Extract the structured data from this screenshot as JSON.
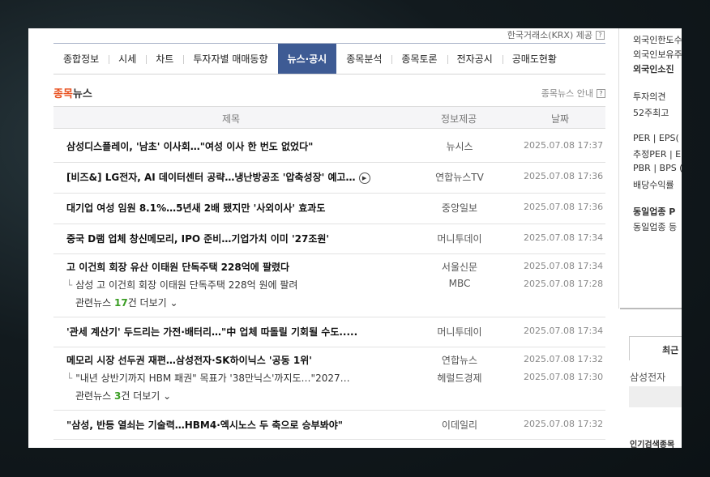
{
  "header": {
    "krx_text": "한국거래소(KRX) 제공",
    "help_glyph": "?"
  },
  "tabs": [
    {
      "label": "종합정보",
      "active": false
    },
    {
      "label": "시세",
      "active": false
    },
    {
      "label": "차트",
      "active": false
    },
    {
      "label": "투자자별 매매동향",
      "active": false
    },
    {
      "label": "뉴스·공시",
      "active": true
    },
    {
      "label": "종목분석",
      "active": false
    },
    {
      "label": "종목토론",
      "active": false
    },
    {
      "label": "전자공시",
      "active": false
    },
    {
      "label": "공매도현황",
      "active": false
    }
  ],
  "section": {
    "title_highlight": "종목",
    "title_rest": "뉴스",
    "guide": "종목뉴스 안내",
    "guide_help": "?"
  },
  "table": {
    "col_title": "제목",
    "col_source": "정보제공",
    "col_date": "날짜"
  },
  "news": [
    {
      "title": "삼성디스플레이, '남초' 이사회…\"여성 이사 한 번도 없었다\"",
      "source": "뉴시스",
      "date": "2025.07.08 17:37"
    },
    {
      "title": "[비즈&] LG전자, AI 데이터센터 공략…냉난방공조 '압축성장' 예고…",
      "source": "연합뉴스TV",
      "date": "2025.07.08 17:36",
      "video": true
    },
    {
      "title": "대기업 여성 임원 8.1%…5년새 2배 됐지만 '사외이사' 효과도",
      "source": "중앙일보",
      "date": "2025.07.08 17:36"
    },
    {
      "title": "중국 D램 업체 창신메모리, IPO 준비…기업가치 이미 '27조원'",
      "source": "머니투데이",
      "date": "2025.07.08 17:34"
    },
    {
      "title": "고 이건희 회장 유산 이태원 단독주택 228억에 팔렸다",
      "source": "서울신문",
      "date": "2025.07.08 17:34",
      "sub": {
        "title": "삼성 고 이건희 회장 이태원 단독주택 228억 원에 팔려",
        "source": "MBC",
        "date": "2025.07.08 17:28"
      },
      "related": {
        "prefix": "관련뉴스 ",
        "count": "17",
        "suffix": "건 더보기"
      }
    },
    {
      "title": "'관세 계산기' 두드리는 가전·배터리…\"中 업체 따돌릴 기회될 수도.....",
      "source": "머니투데이",
      "date": "2025.07.08 17:34"
    },
    {
      "title": "메모리 시장 선두권 재편…삼성전자·SK하이닉스 '공동 1위'",
      "source": "연합뉴스",
      "date": "2025.07.08 17:32",
      "sub": {
        "title": "\"내년 상반기까지 HBM 패권\" 목표가 '38만닉스'까지도…\"2027…",
        "source": "헤럴드경제",
        "date": "2025.07.08 17:30"
      },
      "related": {
        "prefix": "관련뉴스 ",
        "count": "3",
        "suffix": "건 더보기"
      }
    },
    {
      "title": "\"삼성, 반등 열쇠는 기술력…HBM4·엑시노스 두 축으로 승부봐야\"",
      "source": "이데일리",
      "date": "2025.07.08 17:32"
    }
  ],
  "sidebar": {
    "items": [
      "외국인한도수",
      "외국인보유주",
      "외국인소진",
      "투자의견",
      "52주최고",
      "PER | EPS(",
      "추정PER | E",
      "PBR | BPS (",
      "배당수익률",
      "동일업종 P",
      "동일업종 등"
    ],
    "recent_tab": "최근",
    "recent_item": "삼성전자",
    "popular": "인기검색종목"
  }
}
